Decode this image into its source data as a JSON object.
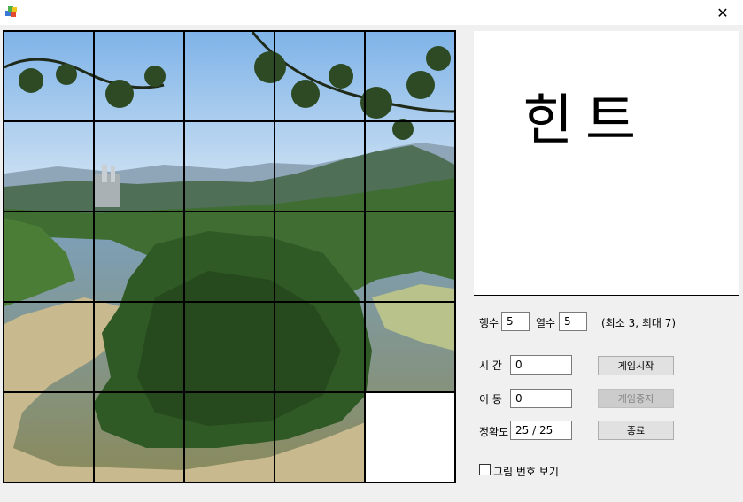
{
  "window": {
    "icon": "app-cube-icon",
    "close_glyph": "✕"
  },
  "hint": {
    "text": "힌트"
  },
  "grid": {
    "rows_label": "행수",
    "rows_value": "5",
    "cols_label": "열수",
    "cols_value": "5",
    "range_note": "(최소 3, 최대 7)"
  },
  "stats": {
    "time_label": "시 간",
    "time_value": "0",
    "moves_label": "이 동",
    "moves_value": "0",
    "accuracy_label": "정확도",
    "accuracy_value": "25 / 25"
  },
  "buttons": {
    "start": "게임시작",
    "stop": "게임중지",
    "exit": "종료"
  },
  "options": {
    "show_numbers_label": "그림 번호 보기",
    "show_numbers_checked": false
  },
  "puzzle": {
    "rows": 5,
    "cols": 5,
    "empty_tile": "row 5, col 5"
  }
}
